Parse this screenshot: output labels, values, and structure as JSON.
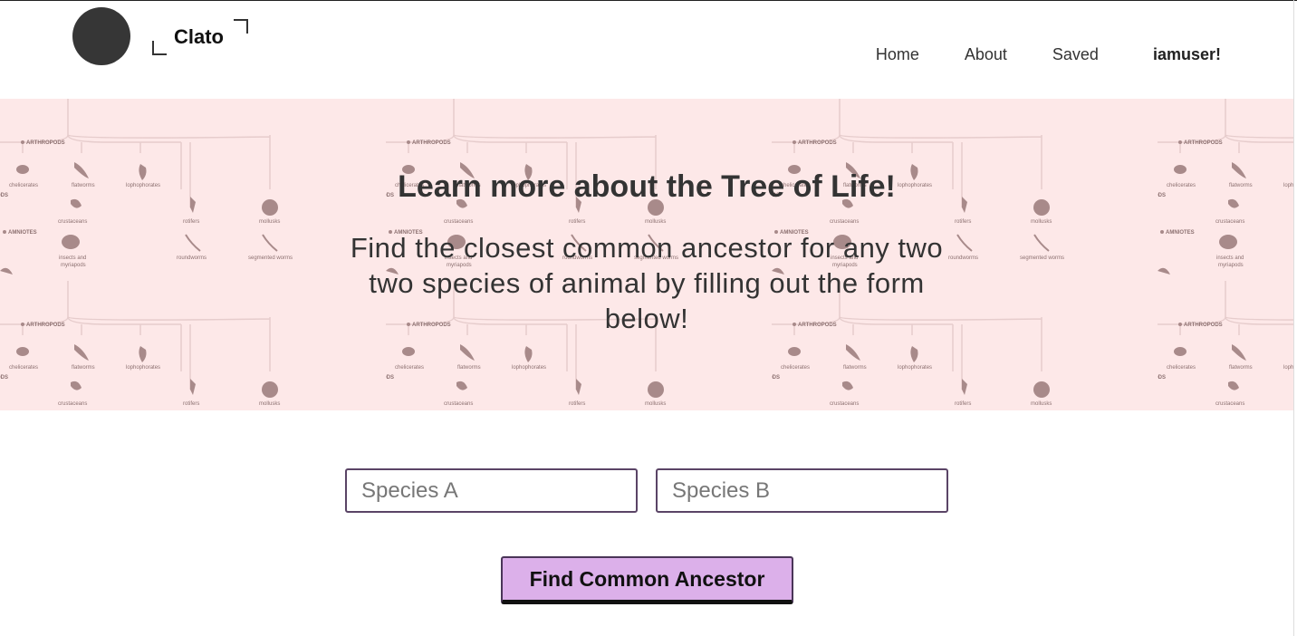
{
  "brand": {
    "name": "Clato"
  },
  "nav": {
    "home": "Home",
    "about": "About",
    "saved": "Saved",
    "user": "iamuser!"
  },
  "hero": {
    "title": "Learn more about the Tree of Life!",
    "subtitle": "Find the closest common ancestor for any two two species of animal by filling out the form below!",
    "background_tree_labels": [
      "ARTHROPODS",
      "AMNIOTES",
      "PODS",
      "chelicerates",
      "flatworms",
      "lophophorates",
      "crustaceans",
      "rotifers",
      "mollusks",
      "insects and myriapods",
      "roundworms",
      "segmented worms"
    ]
  },
  "form": {
    "species_a_placeholder": "Species A",
    "species_b_placeholder": "Species B",
    "submit_label": "Find Common Ancestor"
  },
  "colors": {
    "hero_bg": "#fde8e8",
    "button_bg": "#dcb0ea",
    "field_border": "#5a4466",
    "logo": "#363636"
  }
}
